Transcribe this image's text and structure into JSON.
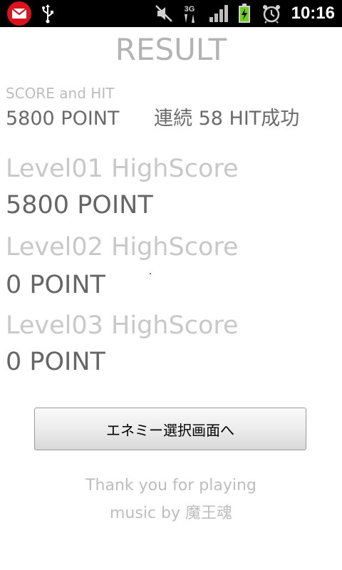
{
  "status_bar": {
    "time": "10:16",
    "network_label": "3G",
    "icons": [
      "gmail-icon",
      "usb-icon",
      "mute-icon",
      "3g-icon",
      "signal-icon",
      "battery-charging-icon",
      "alarm-icon"
    ]
  },
  "result": {
    "title": "RESULT",
    "score_label": "SCORE and HIT",
    "score": "5800 POINT",
    "hit": "連続 58 HIT成功"
  },
  "levels": [
    {
      "label": "Level01 HighScore",
      "score": "5800 POINT"
    },
    {
      "label": "Level02 HighScore",
      "score": "0 POINT"
    },
    {
      "label": "Level03 HighScore",
      "score": "0 POINT"
    }
  ],
  "actions": {
    "enemy_select_label": "エネミー選択画面へ"
  },
  "footer": {
    "thanks": "Thank you for playing",
    "credits": "music by 魔王魂"
  },
  "colors": {
    "status_bar_bg": "#000000",
    "title": "#b3b3b3",
    "label": "#c8c8c8",
    "value": "#666666",
    "battery_charging": "#6fcf1f",
    "gmail_red": "#d9141f"
  }
}
